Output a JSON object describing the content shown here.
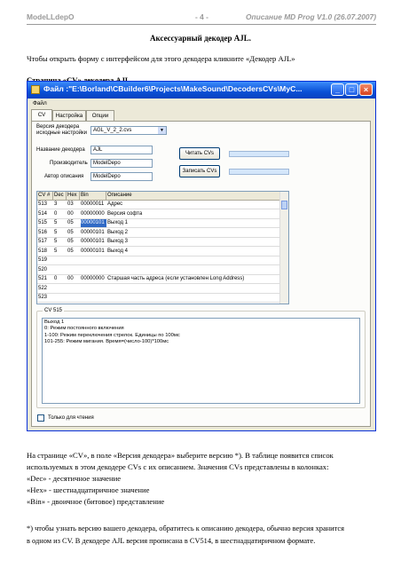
{
  "header": {
    "left": "ModeLLdepO",
    "center": "- 4 -",
    "right": "Описание MD Prog V1.0 (26.07.2007)"
  },
  "section_title": "Аксессуарный декодер AJL.",
  "intro": "Чтобы открыть форму с интерфейсом для этого декодера кликните «Декодер AJL»",
  "page_heading": "Страница «CV» декодера AJL",
  "window": {
    "title": "Файл :\"E:\\Borland\\CBuilder6\\Projects\\MakeSound\\DecodersCVs\\MyC...",
    "minimize": "_",
    "maximize": "□",
    "close": "×",
    "menu": "Файл",
    "tabs": [
      "CV",
      "Настройка",
      "Опции"
    ],
    "version_label_1": "Версия декодера",
    "version_label_2": "исходные настройки",
    "version_value": "AGL_V_2_2.cvs",
    "decoder_name_label": "Название декодера",
    "decoder_name": "AJL",
    "manufacturer_label": "Производитель",
    "manufacturer": "ModelDepo",
    "author_label": "Автор описания",
    "author": "ModelDepo",
    "read_button": "Читать CVs",
    "write_button": "Записать CVs",
    "table_headers": [
      "CV #",
      "Dec",
      "Hex",
      "Bin",
      "Описание"
    ],
    "table_rows": [
      {
        "cv": "513",
        "dec": "3",
        "hex": "03",
        "bin": "00000011",
        "desc": "Адрес"
      },
      {
        "cv": "514",
        "dec": "0",
        "hex": "00",
        "bin": "00000000",
        "desc": "Версия софта"
      },
      {
        "cv": "515",
        "dec": "5",
        "hex": "05",
        "bin": "00000101",
        "desc": "Выход 1"
      },
      {
        "cv": "516",
        "dec": "5",
        "hex": "05",
        "bin": "00000101",
        "desc": "Выход 2"
      },
      {
        "cv": "517",
        "dec": "5",
        "hex": "05",
        "bin": "00000101",
        "desc": "Выход 3"
      },
      {
        "cv": "518",
        "dec": "5",
        "hex": "05",
        "bin": "00000101",
        "desc": "Выход 4"
      },
      {
        "cv": "519",
        "dec": "",
        "hex": "",
        "bin": "",
        "desc": ""
      },
      {
        "cv": "520",
        "dec": "",
        "hex": "",
        "bin": "",
        "desc": ""
      },
      {
        "cv": "521",
        "dec": "0",
        "hex": "00",
        "bin": "00000000",
        "desc": "Старшая часть адреса (если установлен Long Address)"
      },
      {
        "cv": "522",
        "dec": "",
        "hex": "",
        "bin": "",
        "desc": ""
      },
      {
        "cv": "523",
        "dec": "",
        "hex": "",
        "bin": "",
        "desc": ""
      }
    ],
    "selected_row": 2,
    "group_title": "CV 515",
    "group_lines": [
      "Выход 1",
      "0: Режим постоянного включения",
      "1-100: Режим переключения стрелок. Единицы по 100мс",
      "101-255: Режим мигания. Время=(число-100)*100мс"
    ],
    "readonly_label": "Только для чтения"
  },
  "body_paragraph_lines": [
    "На странице «CV», в поле «Версия декодера» выберите версию *). В таблице появится список",
    "используемых в этом декодере CVs с их описанием. Значения CVs представлены в колонках:",
    "«Dec» - десятичное значение",
    "«Hex» - шестнадцатиричное значение",
    "«Bin» - двоичное (битовое) представление"
  ],
  "footnote_lines": [
    "*)  чтобы узнать версию вашего декодера, обратитесь к описанию декодера, обычно версия хранится",
    "в одном из CV. В декодере AJL версия прописана в CV514, в шестнадцатиричном формате."
  ]
}
